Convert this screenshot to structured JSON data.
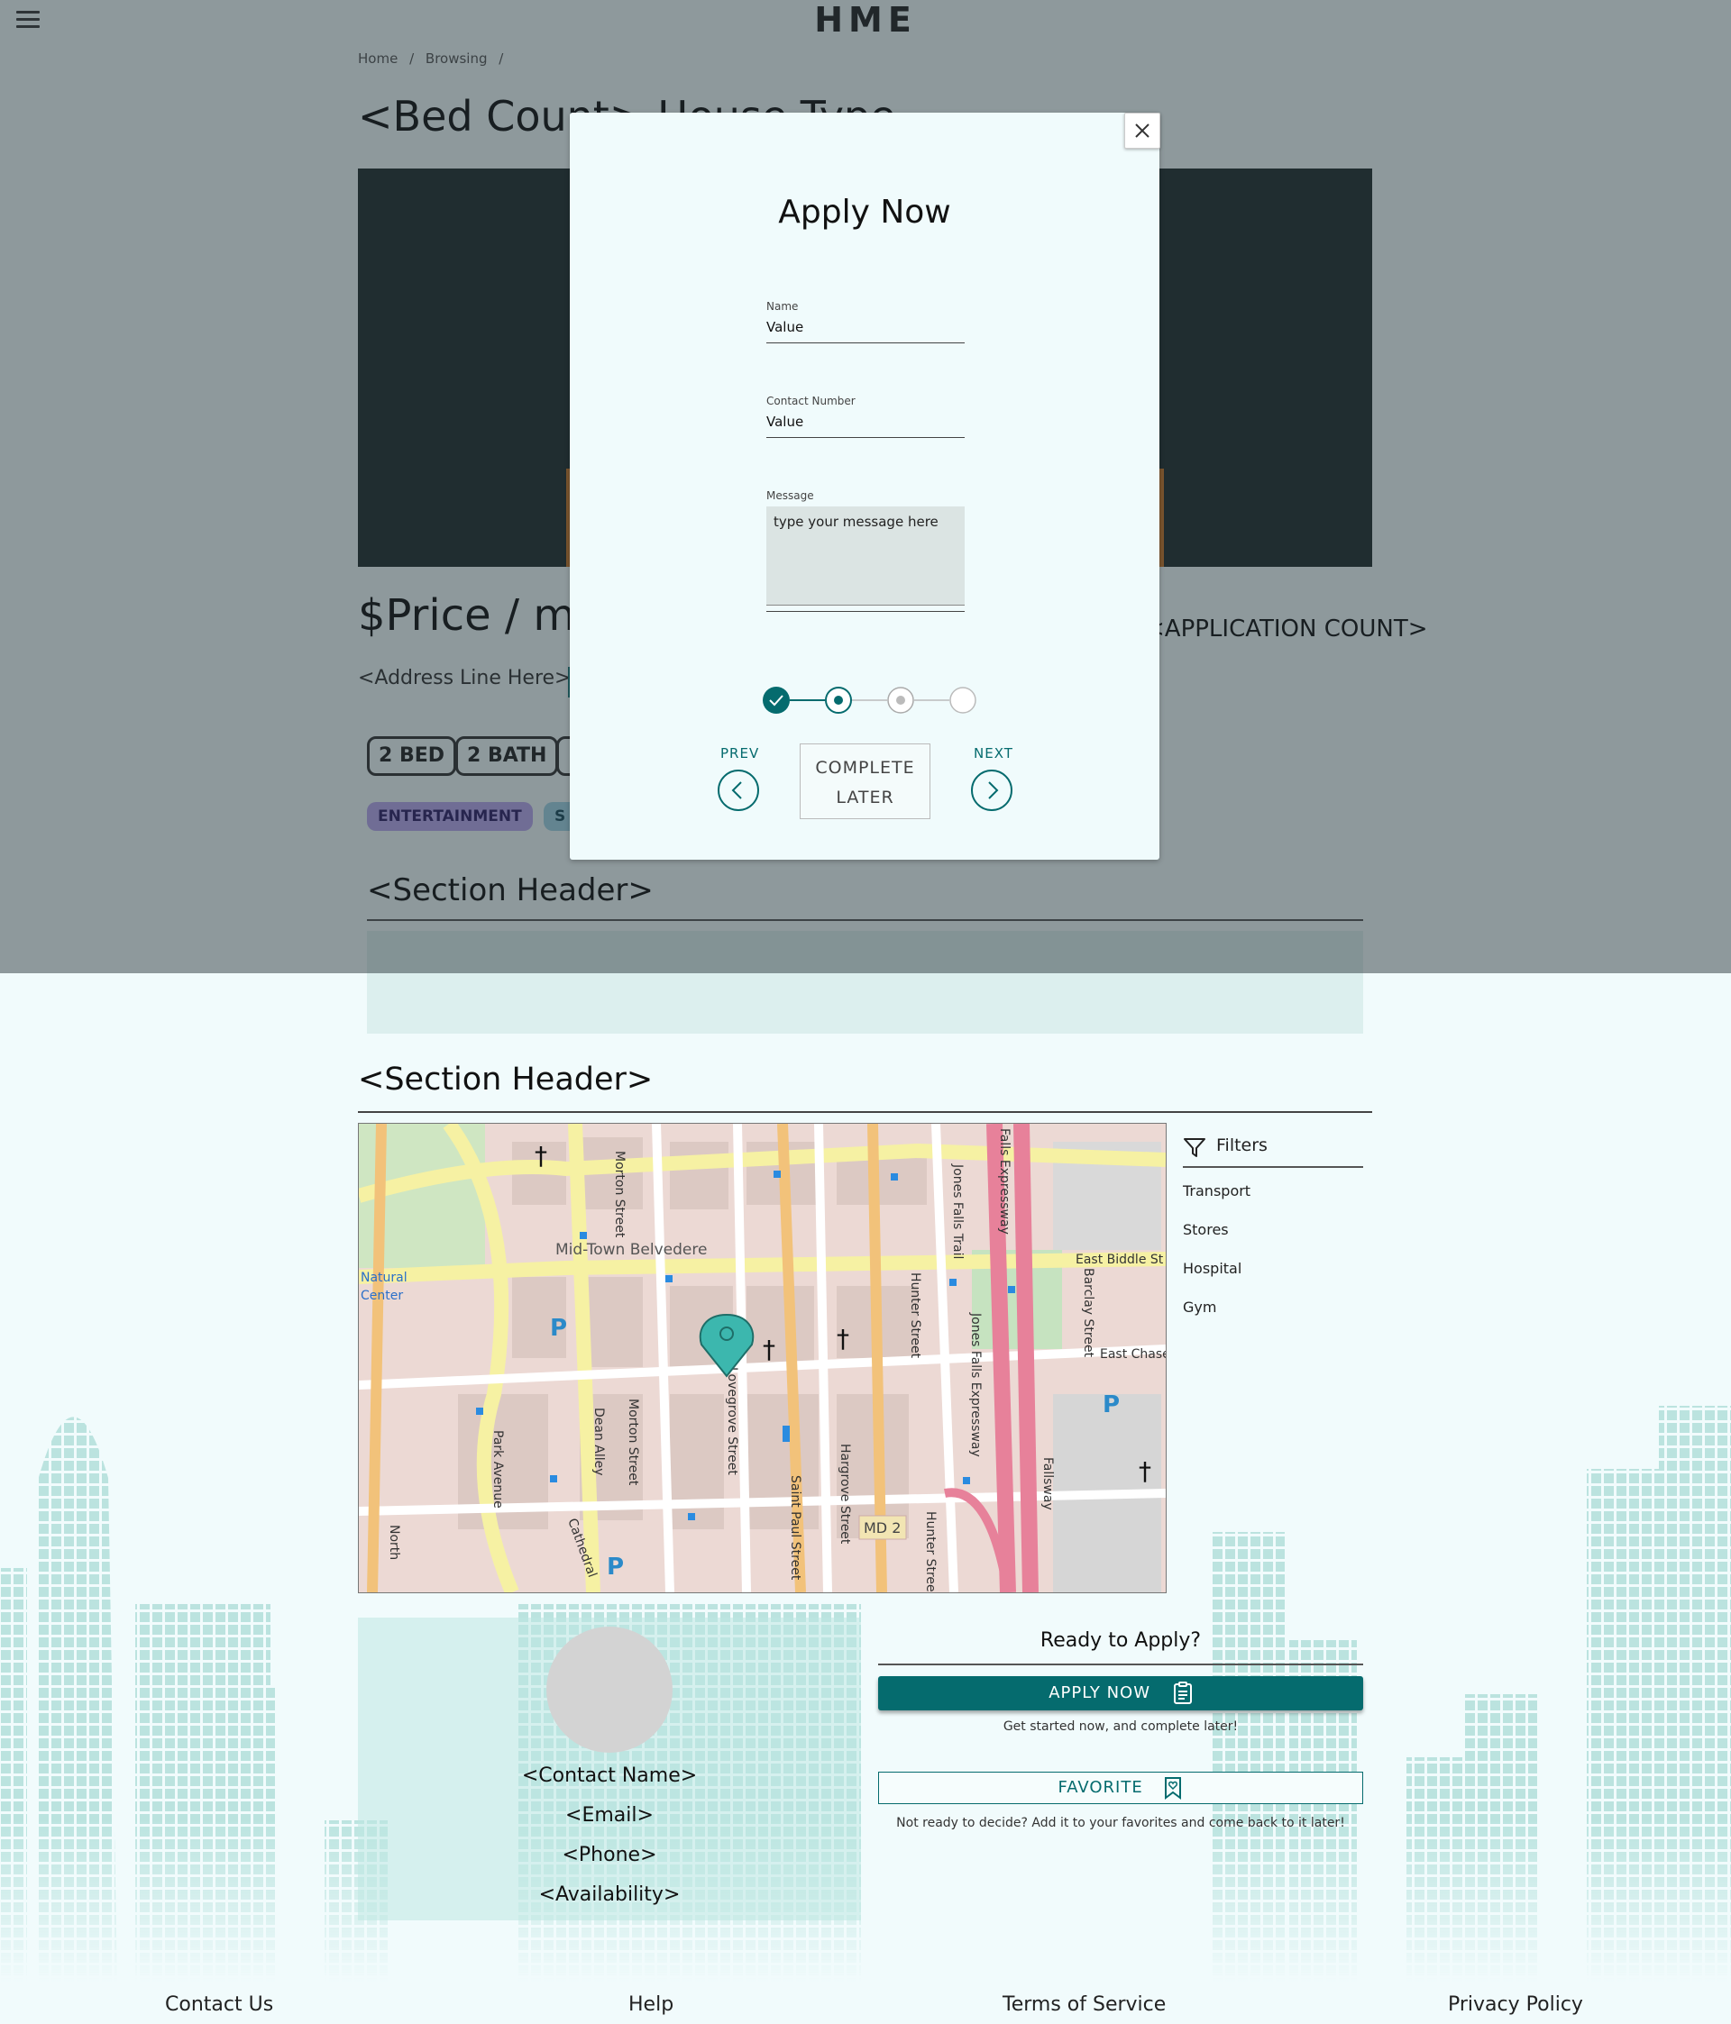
{
  "header": {
    "logo": "HME",
    "menu_icon": "hamburger-icon"
  },
  "breadcrumb": [
    "Home",
    "/",
    "Browsing",
    "/"
  ],
  "property": {
    "title": "<Bed Count> House Type",
    "price": "$Price / mo",
    "application_count": "<APPLICATION COUNT>",
    "address": "<Address Line Here>",
    "chips": [
      "2 BED",
      "2 BATH"
    ],
    "tags": [
      "ENTERTAINMENT",
      "S"
    ]
  },
  "section1": {
    "header": "<Section Header>"
  },
  "section2": {
    "header": "<Section Header>"
  },
  "map": {
    "labels": {
      "district": "Mid-Town Belvedere",
      "route": "MD 2",
      "streets": [
        "Morton Street",
        "Jones Falls Trail",
        "Jones Falls Expressway",
        "Falls Expressway",
        "Hunter Street",
        "Saint Paul Street",
        "Hargrove Street",
        "Lovegrove Street",
        "Park Avenue",
        "Cathedral",
        "Dean Alley",
        "Barclay Street",
        "East Biddle St",
        "East Chase",
        "Fallsway",
        "North",
        "Natural Center"
      ]
    }
  },
  "filters": {
    "title": "Filters",
    "icon": "funnel-icon",
    "items": [
      "Transport",
      "Stores",
      "Hospital",
      "Gym"
    ]
  },
  "contact": {
    "name": "<Contact Name>",
    "email": "<Email>",
    "phone": "<Phone>",
    "availability": "<Availability>"
  },
  "apply_panel": {
    "heading": "Ready to Apply?",
    "apply_label": "APPLY NOW",
    "apply_sub": "Get started now, and complete later!",
    "favorite_label": "FAVORITE",
    "favorite_sub": "Not ready to decide? Add it to your favorites and come back to it later!"
  },
  "footer": {
    "links": [
      "Contact Us",
      "Help",
      "Terms of Service",
      "Privacy Policy"
    ]
  },
  "modal": {
    "title": "Apply Now",
    "fields": {
      "name_label": "Name",
      "name_value": "Value",
      "contact_label": "Contact Number",
      "contact_value": "Value",
      "message_label": "Message",
      "message_placeholder": "type your message here"
    },
    "stepper": {
      "total_steps": 4,
      "completed": 1,
      "current": 2
    },
    "prev_label": "PREV",
    "complete_later_line1": "COMPLETE",
    "complete_later_line2": "LATER",
    "next_label": "NEXT"
  },
  "colors": {
    "accent": "#056b6e",
    "background": "#f1fbfc",
    "overlay": "#222e34"
  }
}
